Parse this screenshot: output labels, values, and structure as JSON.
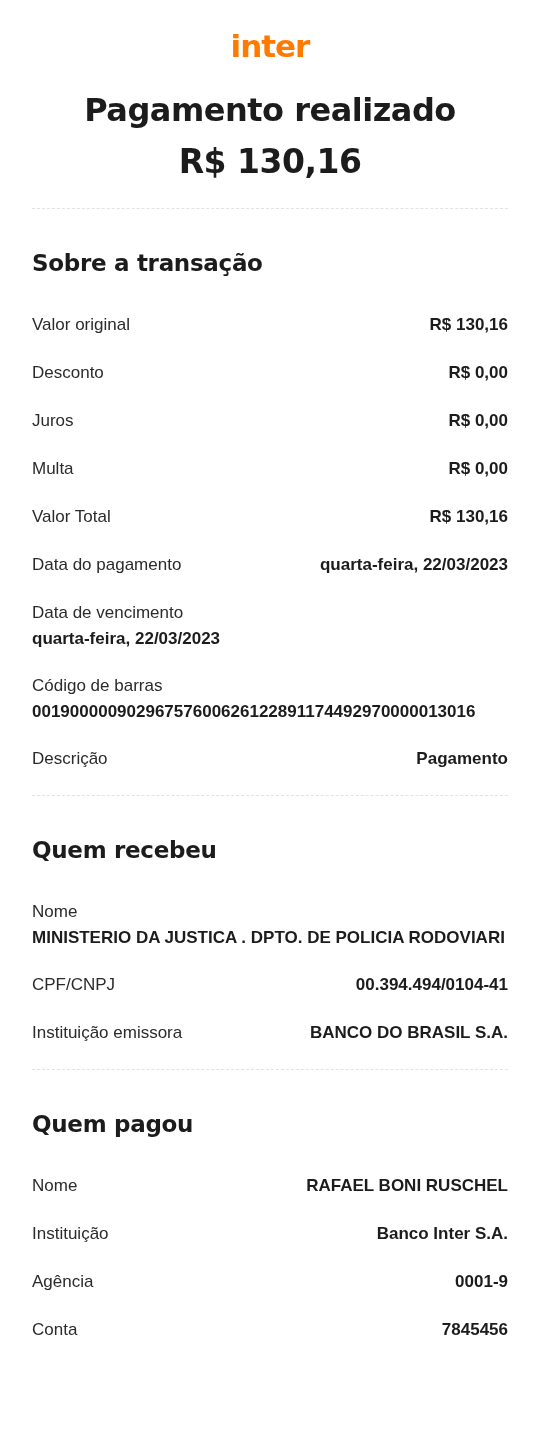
{
  "logo": "inter",
  "title": "Pagamento realizado",
  "amount": "R$ 130,16",
  "sections": [
    {
      "heading": "Sobre a transação",
      "rows": [
        {
          "kind": "inline",
          "label": "Valor original",
          "value": "R$ 130,16"
        },
        {
          "kind": "inline",
          "label": "Desconto",
          "value": "R$ 0,00"
        },
        {
          "kind": "inline",
          "label": "Juros",
          "value": "R$ 0,00"
        },
        {
          "kind": "inline",
          "label": "Multa",
          "value": "R$ 0,00"
        },
        {
          "kind": "inline",
          "label": "Valor Total",
          "value": "R$ 130,16"
        },
        {
          "kind": "inline",
          "label": "Data do pagamento",
          "value": "quarta-feira, 22/03/2023"
        },
        {
          "kind": "stacked",
          "label": "Data de vencimento",
          "value": "quarta-feira, 22/03/2023"
        },
        {
          "kind": "stacked",
          "label": "Código de barras",
          "value": "00190000090296757600626122891174492970000013016"
        },
        {
          "kind": "inline",
          "label": "Descrição",
          "value": "Pagamento"
        }
      ]
    },
    {
      "heading": "Quem recebeu",
      "rows": [
        {
          "kind": "stacked",
          "label": "Nome",
          "value": "MINISTERIO DA JUSTICA . DPTO. DE POLICIA RODOVIARI"
        },
        {
          "kind": "inline",
          "label": "CPF/CNPJ",
          "value": "00.394.494/0104-41"
        },
        {
          "kind": "inline",
          "label": "Instituição emissora",
          "value": "BANCO DO BRASIL S.A."
        }
      ]
    },
    {
      "heading": "Quem pagou",
      "rows": [
        {
          "kind": "inline",
          "label": "Nome",
          "value": "RAFAEL BONI RUSCHEL"
        },
        {
          "kind": "inline",
          "label": "Instituição",
          "value": "Banco Inter S.A."
        },
        {
          "kind": "inline",
          "label": "Agência",
          "value": "0001-9"
        },
        {
          "kind": "inline",
          "label": "Conta",
          "value": "7845456"
        }
      ]
    }
  ]
}
